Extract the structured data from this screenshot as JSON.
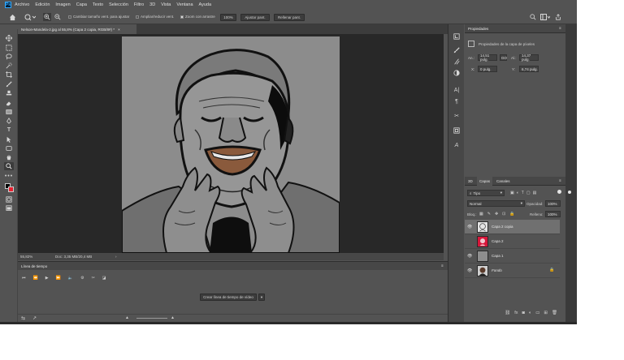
{
  "menu": [
    "Archivo",
    "Edición",
    "Imagen",
    "Capa",
    "Texto",
    "Selección",
    "Filtro",
    "3D",
    "Vista",
    "Ventana",
    "Ayuda"
  ],
  "app_badge": "Ps",
  "options_bar": {
    "resize_windows_label": "Cambiar tamaño vent. para ajustar",
    "zoom_all_windows_label": "Ampliar/reducir vent.",
    "scrubby_zoom_label": "Zoom con arrastre",
    "zoom_value": "100%",
    "fit_screen_label": "Ajustar pant.",
    "fill_screen_label": "Rellenar pant."
  },
  "document_tab": {
    "title": "Nelson-Mandela-2.jpg al 55,8% (Capa 2 copia, RGB/8#) *",
    "close": "×"
  },
  "status": {
    "zoom": "55,82%",
    "doc": "Doc: 3,35 MB/20,4 MB",
    "arrow": "›"
  },
  "timeline": {
    "tab": "Línea de tiempo",
    "create_button": "Crear línea de tiempo de vídeo"
  },
  "properties": {
    "tab": "Propiedades",
    "subtitle": "Propiedades de la capa de píxeles",
    "an_label": "An.:",
    "an_value": "14,51 pulg.",
    "link_label": "GO",
    "al_label": "Al.:",
    "al_value": "14,37 pulg.",
    "x_label": "X:",
    "x_value": "0 pulg.",
    "y_label": "Y:",
    "y_value": "6,74 pulg."
  },
  "layers_panel": {
    "tabs": [
      "3D",
      "Capas",
      "Canales"
    ],
    "active_tab": "Capas",
    "kind_filter": "Tipo",
    "blend_mode": "Normal",
    "opacity_label": "Opacidad:",
    "opacity_value": "100%",
    "lock_label": "Bloq.:",
    "fill_label": "Relleno:",
    "fill_value": "100%",
    "layers": [
      {
        "name": "Capa 2 copia",
        "selected": true,
        "thumb": "sketch"
      },
      {
        "name": "Capa 2",
        "selected": false,
        "thumb": "red"
      },
      {
        "name": "Capa 1",
        "selected": false,
        "thumb": "gray"
      },
      {
        "name": "Fondo",
        "selected": false,
        "thumb": "portrait",
        "locked": true
      }
    ]
  },
  "colors": {
    "foreground": "#000000",
    "background": "#e8202f",
    "accent": "#31a8ff"
  }
}
